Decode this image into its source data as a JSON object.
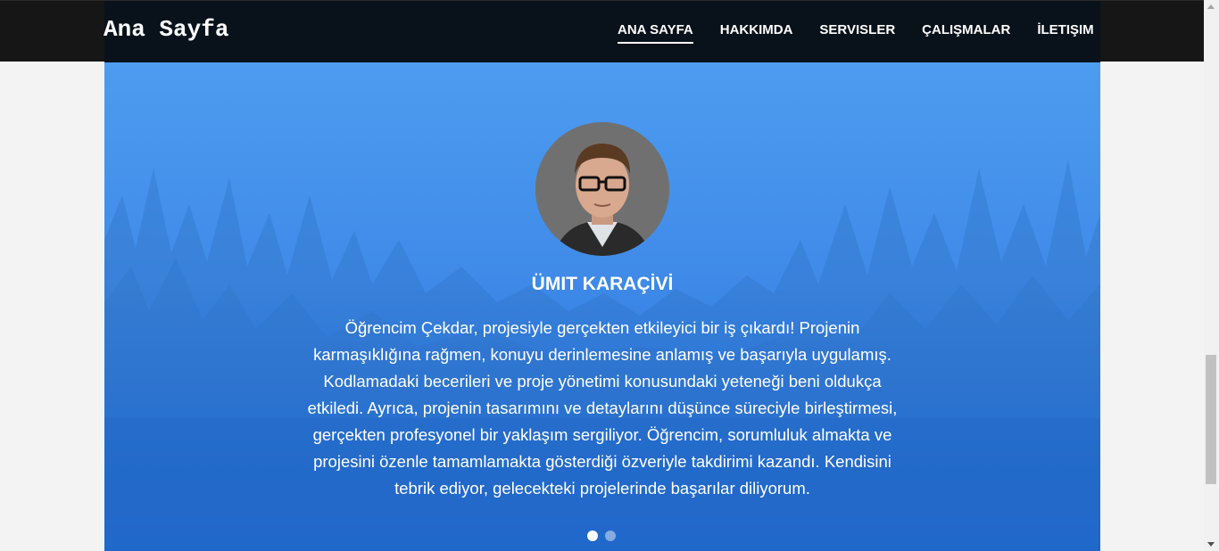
{
  "header": {
    "brand": "Ana Sayfa",
    "nav": [
      {
        "label": "ANA SAYFA"
      },
      {
        "label": "HAKKIMDA"
      },
      {
        "label": "SERVISLER"
      },
      {
        "label": "ÇALIŞMALAR"
      },
      {
        "label": "İLETIŞIM"
      }
    ]
  },
  "testimonial": {
    "name": "ÜMIT KARAÇİVİ",
    "lines": [
      "Öğrencim Çekdar, projesiyle gerçekten etkileyici bir iş çıkardı! Projenin",
      "karmaşıklığına rağmen, konuyu derinlemesine anlamış ve başarıyla uygulamış.",
      "Kodlamadaki becerileri ve proje yönetimi konusundaki yeteneği beni oldukça",
      "etkiledi. Ayrıca, projenin tasarımını ve detaylarını düşünce süreciyle birleştirmesi,",
      "gerçekten profesyonel bir yaklaşım sergiliyor. Öğrencim, sorumluluk almakta ve",
      "projesini özenle tamamlamakta gösterdiği özveriyle takdirimi kazandı. Kendisini",
      "tebrik ediyor, gelecekteki projelerinde başarılar diliyorum."
    ]
  },
  "carousel": {
    "active_index": 0,
    "count": 2
  },
  "colors": {
    "accent": "#1f6fdc",
    "header_bg": "#09111a"
  }
}
